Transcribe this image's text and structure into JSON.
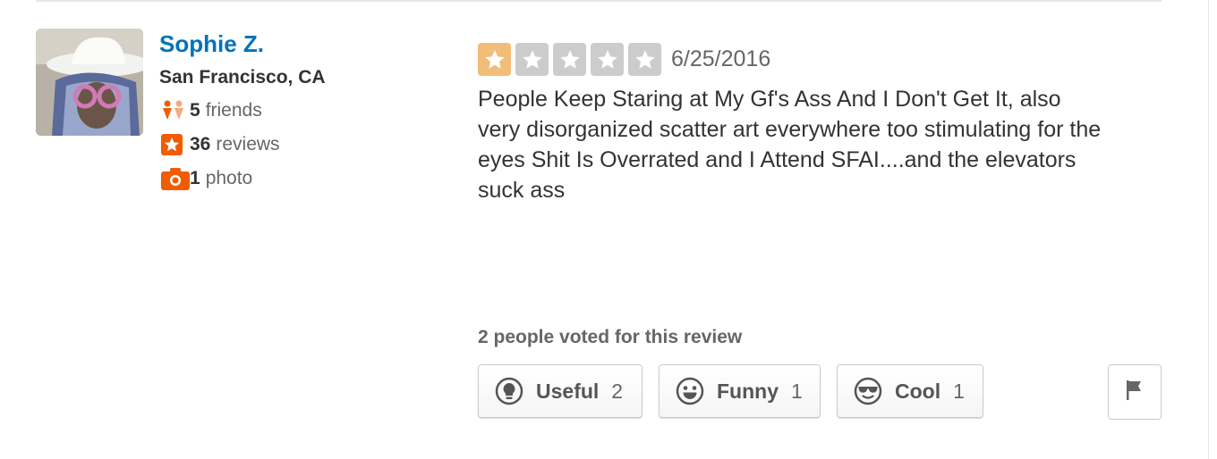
{
  "user": {
    "name": "Sophie Z.",
    "location": "San Francisco, CA",
    "stats": {
      "friends_count": "5",
      "friends_label": "friends",
      "reviews_count": "36",
      "reviews_label": "reviews",
      "photos_count": "1",
      "photos_label": "photo"
    }
  },
  "review": {
    "rating": 1,
    "max_rating": 5,
    "date": "6/25/2016",
    "text": "People Keep Staring at My Gf's Ass And I Don't Get It, also very disorganized scatter art everywhere too stimulating for the eyes Shit Is Overrated and I Attend SFAI....and the elevators suck ass"
  },
  "votes": {
    "heading": "2 people voted for this review",
    "buttons": [
      {
        "label": "Useful",
        "count": "2",
        "icon": "lightbulb-icon"
      },
      {
        "label": "Funny",
        "count": "1",
        "icon": "smiley-icon"
      },
      {
        "label": "Cool",
        "count": "1",
        "icon": "sunglasses-icon"
      }
    ],
    "flag_icon": "flag-icon"
  },
  "colors": {
    "user_link": "#0073bb",
    "star_on": "#f2bd79",
    "star_off": "#cccccc",
    "stat_icon": "#f15c00"
  }
}
